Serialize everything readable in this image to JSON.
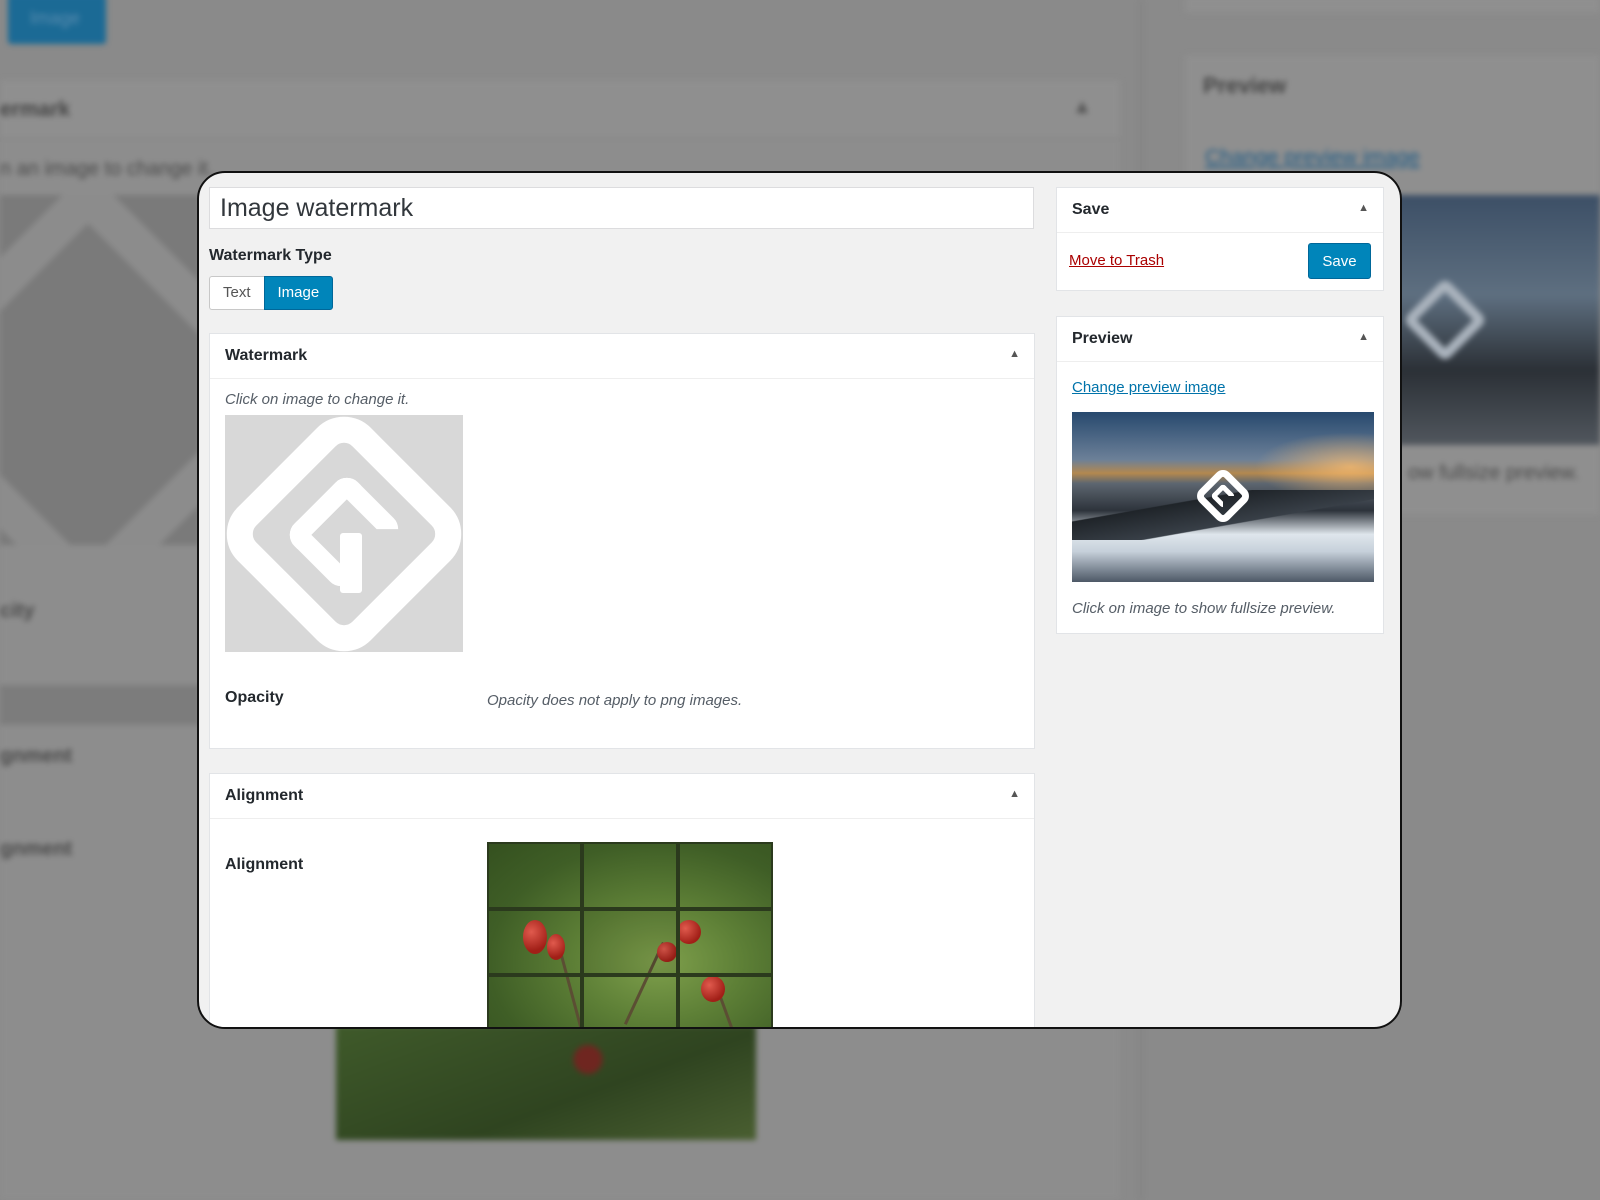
{
  "background": {
    "top_button_label": "Image",
    "panel_title": "ermark",
    "hint": "n an image to change it.",
    "opacity_label": "city",
    "alignment_label_1": "gnment",
    "alignment_label_2": "gnment",
    "preview_title": "Preview",
    "preview_link": "Change preview image",
    "preview_note": "ow fullsize preview."
  },
  "title": {
    "value": "Image watermark"
  },
  "watermark_type": {
    "label": "Watermark Type",
    "options": [
      "Text",
      "Image"
    ],
    "selected": "Image"
  },
  "watermark_box": {
    "title": "Watermark",
    "toggle_icon": "triangle-up-icon",
    "hint": "Click on image to change it.",
    "opacity_label": "Opacity",
    "opacity_note": "Opacity does not apply to png images."
  },
  "alignment_box": {
    "title": "Alignment",
    "toggle_icon": "triangle-up-icon",
    "label": "Alignment",
    "grid_cells": [
      "top-left",
      "top-center",
      "top-right",
      "middle-left",
      "middle-center",
      "middle-right",
      "bottom-left",
      "bottom-center",
      "bottom-right"
    ],
    "selected_cell": "middle-center"
  },
  "save_box": {
    "title": "Save",
    "toggle_icon": "triangle-up-icon",
    "trash_label": "Move to Trash",
    "save_label": "Save"
  },
  "preview_box": {
    "title": "Preview",
    "toggle_icon": "triangle-up-icon",
    "link": "Change preview image",
    "note": "Click on image to show fullsize preview."
  },
  "colors": {
    "primary": "#0085ba",
    "link": "#0073aa",
    "trash": "#a00",
    "panel_bg": "#f1f1f1",
    "overlay": "#8a8a8a"
  }
}
